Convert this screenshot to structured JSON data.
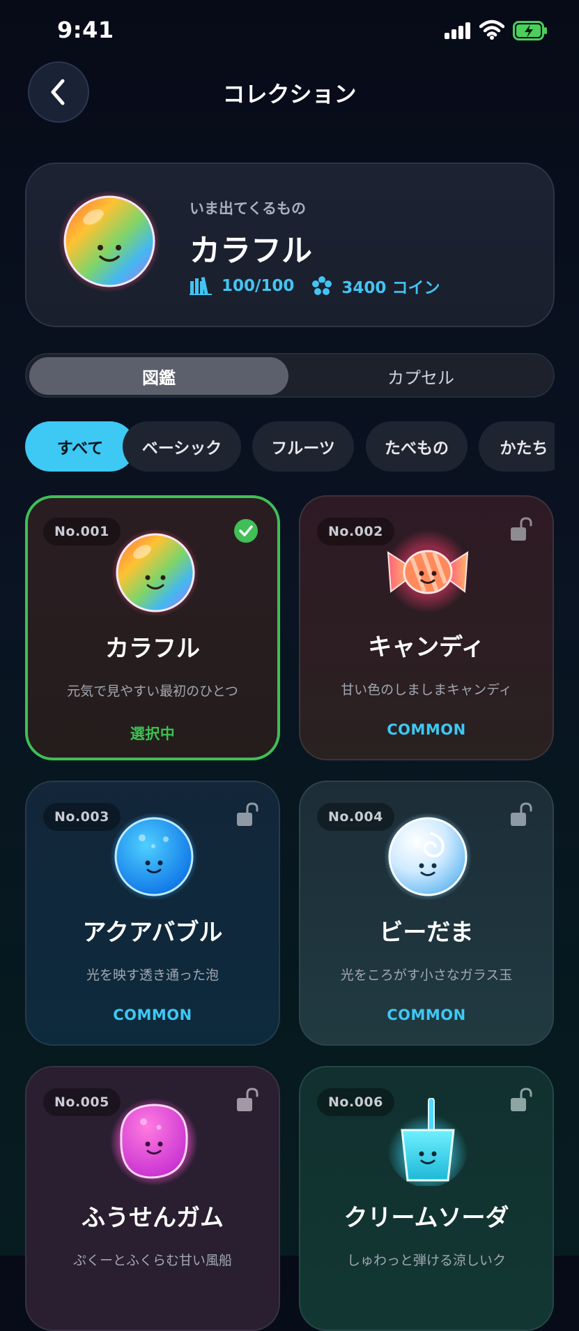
{
  "status_bar": {
    "time": "9:41"
  },
  "nav": {
    "title": "コレクション"
  },
  "current": {
    "subtitle": "いま出てくるもの",
    "name": "カラフル",
    "progress": "100/100",
    "coins": "3400 コイン"
  },
  "segment": {
    "tabs": [
      {
        "label": "図鑑"
      },
      {
        "label": "カプセル"
      }
    ],
    "selected": "図鑑"
  },
  "chips": [
    {
      "label": "すべて"
    },
    {
      "label": "ベーシック"
    },
    {
      "label": "フルーツ"
    },
    {
      "label": "たべもの"
    },
    {
      "label": "かたち"
    }
  ],
  "chips_selected": "すべて",
  "cards": [
    {
      "number": "No.001",
      "name": "カラフル",
      "desc": "元気で見やすい最初のひとつ",
      "rarity": "選択中",
      "state": "selected",
      "icon": "rainbow-orb-icon"
    },
    {
      "number": "No.002",
      "name": "キャンディ",
      "desc": "甘い色のしましまキャンディ",
      "rarity": "COMMON",
      "state": "unlocked",
      "icon": "candy-icon"
    },
    {
      "number": "No.003",
      "name": "アクアバブル",
      "desc": "光を映す透き通った泡",
      "rarity": "COMMON",
      "state": "unlocked",
      "icon": "aqua-bubble-icon"
    },
    {
      "number": "No.004",
      "name": "ビーだま",
      "desc": "光をころがす小さなガラス玉",
      "rarity": "COMMON",
      "state": "unlocked",
      "icon": "marble-icon"
    },
    {
      "number": "No.005",
      "name": "ふうせんガム",
      "desc": "ぷくーとふくらむ甘い風船",
      "rarity": "",
      "state": "unlocked",
      "icon": "bubblegum-icon"
    },
    {
      "number": "No.006",
      "name": "クリームソーダ",
      "desc": "しゅわっと弾ける涼しいク",
      "rarity": "",
      "state": "unlocked",
      "icon": "cream-soda-icon"
    }
  ],
  "colors": {
    "accent": "#3ec8f4",
    "selected": "#3fbf55",
    "background": "#070b18"
  }
}
